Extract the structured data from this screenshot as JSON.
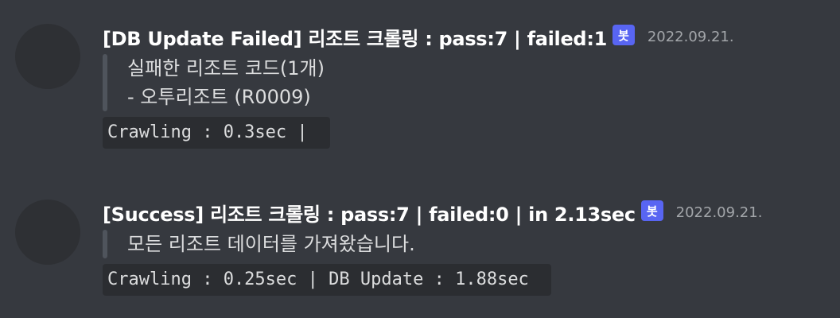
{
  "messages": [
    {
      "title": "[DB Update Failed] 리조트 크롤링 : pass:7  |  failed:1",
      "badge": "봇",
      "timestamp": "2022.09.21.",
      "quote_lines": [
        "실패한 리조트 코드(1개)",
        "- 오투리조트 (R0009)"
      ],
      "code": "Crawling : 0.3sec |"
    },
    {
      "title": "[Success] 리조트 크롤링 : pass:7  |  failed:0  |  in 2.13sec",
      "badge": "봇",
      "timestamp": "2022.09.21.",
      "quote_lines": [
        "모든 리조트 데이터를 가져왔습니다."
      ],
      "code": "Crawling : 0.25sec | DB Update : 1.88sec"
    }
  ]
}
